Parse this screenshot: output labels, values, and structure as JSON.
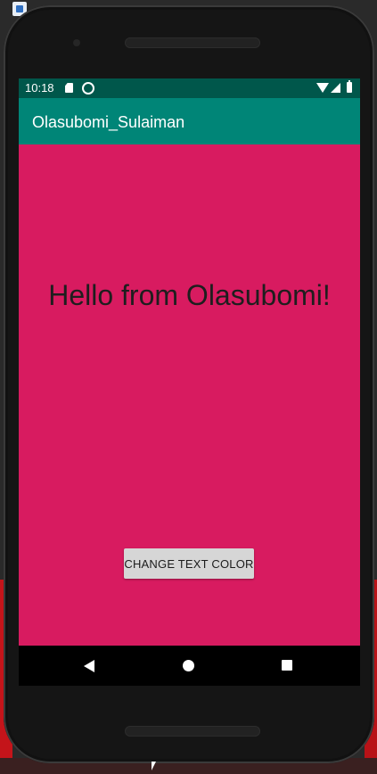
{
  "status_bar": {
    "time": "10:18",
    "icons": [
      "sd-card-icon",
      "sync-icon",
      "wifi-icon",
      "signal-icon",
      "battery-icon"
    ]
  },
  "app_bar": {
    "title": "Olasubomi_Sulaiman",
    "color": "#008577"
  },
  "main": {
    "background_color": "#d81b60",
    "message": "Hello from Olasubomi!",
    "button_label": "CHANGE TEXT COLOR"
  },
  "nav_bar": {
    "icons": [
      "back-icon",
      "home-icon",
      "recents-icon"
    ]
  },
  "colors": {
    "status_bar": "#00574b",
    "app_bar": "#008577",
    "content_background": "#d81b60",
    "button": "#d6d6d6"
  }
}
